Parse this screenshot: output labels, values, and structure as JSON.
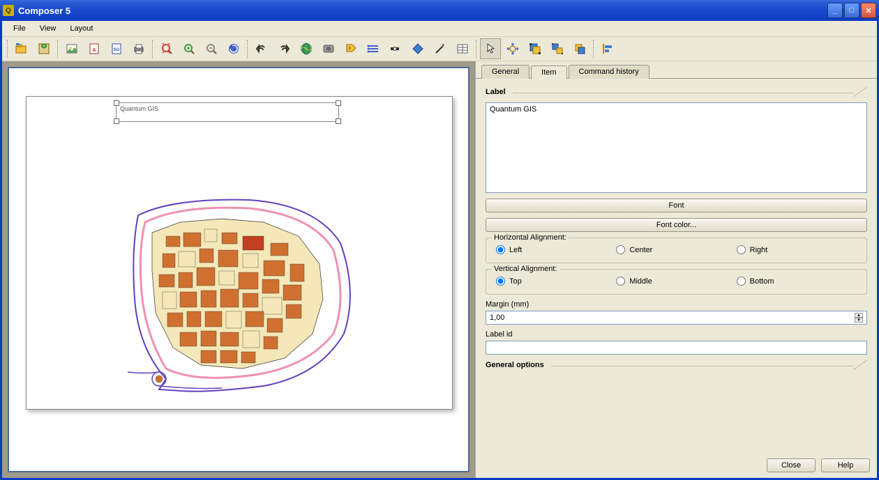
{
  "window": {
    "title": "Composer 5"
  },
  "menu": {
    "items": [
      "File",
      "View",
      "Layout"
    ]
  },
  "tabs": {
    "general": "General",
    "item": "Item",
    "history": "Command history",
    "active": "item"
  },
  "canvas": {
    "label_text": "Quantum GIS"
  },
  "panel": {
    "section_title": "Label",
    "text_value": "Quantum GIS",
    "font_button": "Font",
    "font_color_button": "Font color...",
    "h_align": {
      "legend": "Horizontal Alignment:",
      "left": "Left",
      "center": "Center",
      "right": "Right",
      "value": "left"
    },
    "v_align": {
      "legend": "Vertical Alignment:",
      "top": "Top",
      "middle": "Middle",
      "bottom": "Bottom",
      "value": "top"
    },
    "margin_label": "Margin (mm)",
    "margin_value": "1,00",
    "label_id_label": "Label id",
    "label_id_value": "",
    "general_options": "General options"
  },
  "dialog": {
    "close": "Close",
    "help": "Help"
  }
}
